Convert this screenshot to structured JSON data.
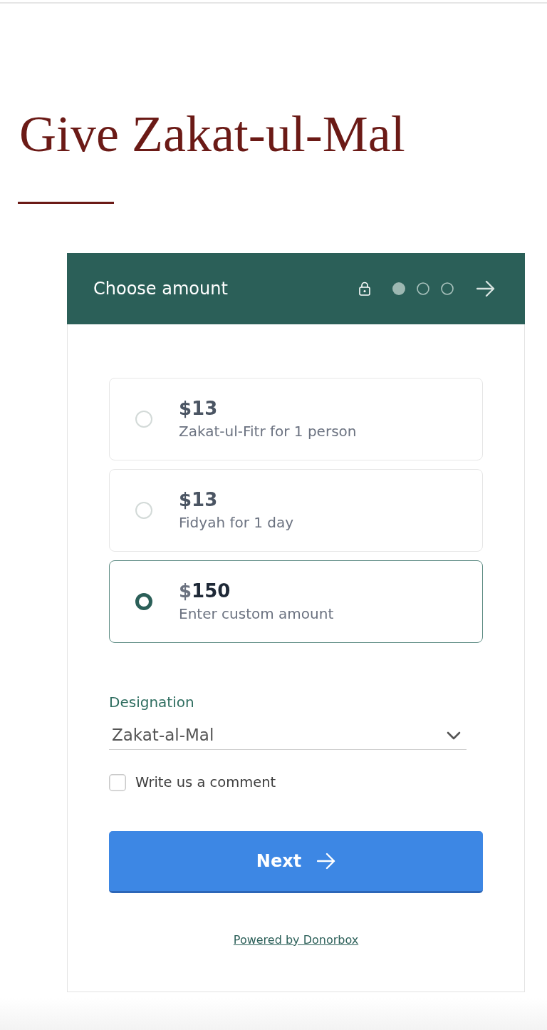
{
  "page_title": "Give Zakat-ul-Mal",
  "form": {
    "header": {
      "title": "Choose amount",
      "steps": [
        {
          "selected": true
        },
        {
          "selected": false
        },
        {
          "selected": false
        }
      ]
    },
    "amounts": [
      {
        "currency": "$",
        "value": "13",
        "description": "Zakat-ul-Fitr for 1 person",
        "selected": false
      },
      {
        "currency": "$",
        "value": "13",
        "description": "Fidyah for 1 day",
        "selected": false
      },
      {
        "currency": "$",
        "value": "150",
        "description": "Enter custom amount",
        "selected": true
      }
    ],
    "designation": {
      "label": "Designation",
      "value": "Zakat-al-Mal"
    },
    "comment": {
      "label": "Write us a comment",
      "checked": false
    },
    "next_button": {
      "label": "Next"
    },
    "footer_link": "Powered by Donorbox"
  }
}
